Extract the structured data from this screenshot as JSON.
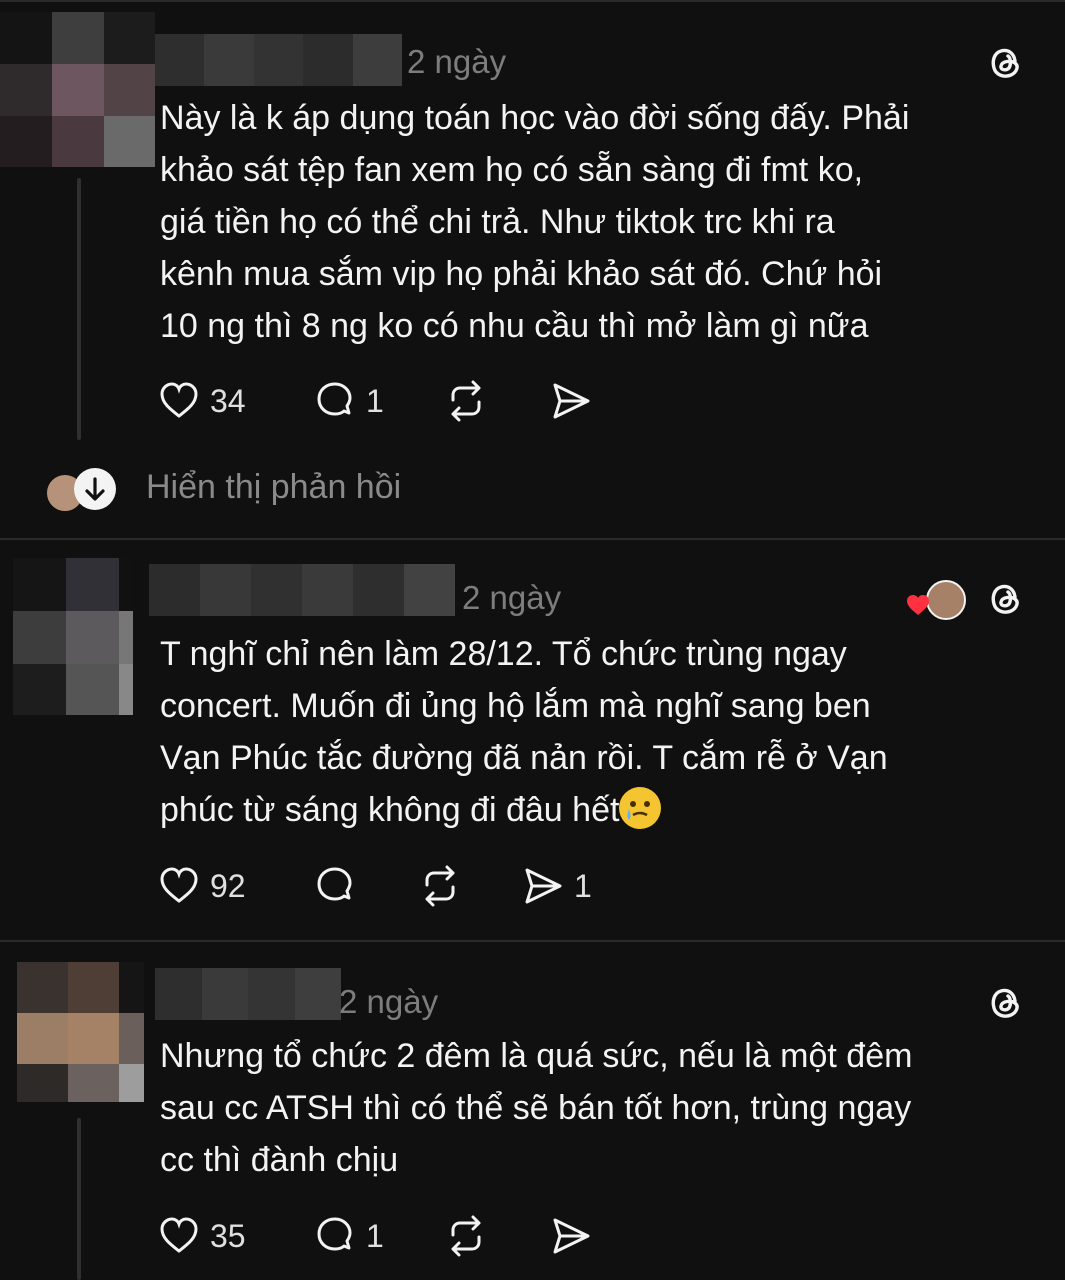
{
  "comments": [
    {
      "time": "2 ngày",
      "text": "Này là k áp dụng toán học vào đời sống đấy. Phải khảo sát tệp fan xem họ có sẵn sàng đi fmt ko, giá tiền họ có thể chi trả. Như tiktok trc khi ra kênh mua sắm vip họ phải khảo sát đó. Chứ hỏi 10 ng thì 8 ng ko có nhu cầu thì mở làm gì nữa",
      "lines": [
        "Này là k áp dụng toán học vào đời sống đấy. Phải",
        "khảo sát tệp fan xem họ có sẵn sàng đi fmt ko,",
        "giá tiền họ có thể chi trả. Như tiktok trc khi ra",
        "kênh mua sắm vip họ phải khảo sát đó. Chứ hỏi",
        "10 ng thì 8 ng ko có nhu cầu thì mở làm gì nữa"
      ],
      "likes": "34",
      "replies": "1",
      "reposts": "",
      "shares": ""
    },
    {
      "time": "2 ngày",
      "lines": [
        "T nghĩ chỉ nên làm 28/12. Tổ chức trùng ngay",
        "concert. Muốn đi ủng hộ lắm mà nghĩ sang ben",
        "Vạn Phúc tắc đường đã nản rồi. T cắm rễ ở Vạn",
        "phúc từ sáng không đi đâu hết"
      ],
      "emoji": "face-holding-back-tears",
      "likes": "92",
      "replies": "",
      "reposts": "",
      "shares": "1"
    },
    {
      "time": "2 ngày",
      "lines": [
        "Nhưng tổ chức 2 đêm là quá sức, nếu là một đêm",
        "sau cc ATSH thì có thể sẽ bán tốt hơn, trùng ngay",
        "cc thì đành chịu"
      ],
      "likes": "35",
      "replies": "1",
      "reposts": "",
      "shares": ""
    }
  ],
  "show_replies_label": "Hiển thị phản hồi",
  "colors": {
    "background": "#101010",
    "text": "#f3f3f3",
    "muted": "#7d7d7d",
    "divider": "#2a2a2a",
    "heart_red": "#ff3040"
  },
  "icons": [
    "heart-icon",
    "comment-icon",
    "repost-icon",
    "share-icon",
    "threads-logo-icon",
    "arrow-down-icon"
  ]
}
